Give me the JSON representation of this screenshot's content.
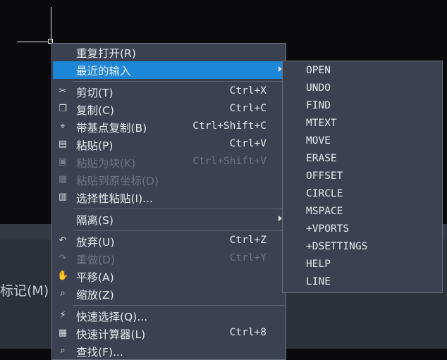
{
  "background": {
    "partial_label": "标记(M)"
  },
  "context_menu": {
    "items": [
      {
        "label": "重复打开(R)",
        "shortcut": "",
        "icon": "none",
        "disabled": false,
        "submenu": false,
        "highlighted": false
      },
      {
        "label": "最近的输入",
        "shortcut": "",
        "icon": "none",
        "disabled": false,
        "submenu": true,
        "highlighted": true
      },
      {
        "label": "剪切(T)",
        "shortcut": "Ctrl+X",
        "icon": "scissors-icon",
        "disabled": false,
        "submenu": false,
        "highlighted": false
      },
      {
        "label": "复制(C)",
        "shortcut": "Ctrl+C",
        "icon": "copy-icon",
        "disabled": false,
        "submenu": false,
        "highlighted": false
      },
      {
        "label": "带基点复制(B)",
        "shortcut": "Ctrl+Shift+C",
        "icon": "copy-with-basepoint-icon",
        "disabled": false,
        "submenu": false,
        "highlighted": false
      },
      {
        "label": "粘贴(P)",
        "shortcut": "Ctrl+V",
        "icon": "paste-icon",
        "disabled": false,
        "submenu": false,
        "highlighted": false
      },
      {
        "label": "粘贴为块(K)",
        "shortcut": "Ctrl+Shift+V",
        "icon": "paste-as-block-icon",
        "disabled": true,
        "submenu": false,
        "highlighted": false
      },
      {
        "label": "粘贴到原坐标(D)",
        "shortcut": "",
        "icon": "paste-original-coords-icon",
        "disabled": true,
        "submenu": false,
        "highlighted": false
      },
      {
        "label": "选择性粘贴(I)...",
        "shortcut": "",
        "icon": "paste-special-icon",
        "disabled": false,
        "submenu": false,
        "highlighted": false
      },
      {
        "label": "隔离(S)",
        "shortcut": "",
        "icon": "none",
        "disabled": false,
        "submenu": true,
        "highlighted": false
      },
      {
        "label": "放弃(U)",
        "shortcut": "Ctrl+Z",
        "icon": "undo-icon",
        "disabled": false,
        "submenu": false,
        "highlighted": false
      },
      {
        "label": "重做(D)",
        "shortcut": "Ctrl+Y",
        "icon": "redo-icon",
        "disabled": true,
        "submenu": false,
        "highlighted": false
      },
      {
        "label": "平移(A)",
        "shortcut": "",
        "icon": "pan-hand-icon",
        "disabled": false,
        "submenu": false,
        "highlighted": false
      },
      {
        "label": "缩放(Z)",
        "shortcut": "",
        "icon": "zoom-icon",
        "disabled": false,
        "submenu": false,
        "highlighted": false
      },
      {
        "label": "快速选择(Q)...",
        "shortcut": "",
        "icon": "quick-select-icon",
        "disabled": false,
        "submenu": false,
        "highlighted": false
      },
      {
        "label": "快速计算器(L)",
        "shortcut": "Ctrl+8",
        "icon": "calculator-icon",
        "disabled": false,
        "submenu": false,
        "highlighted": false
      },
      {
        "label": "查找(F)...",
        "shortcut": "",
        "icon": "find-icon",
        "disabled": false,
        "submenu": false,
        "highlighted": false
      }
    ]
  },
  "recent_input_submenu": {
    "items": [
      "OPEN",
      "UNDO",
      "FIND",
      "MTEXT",
      "MOVE",
      "ERASE",
      "OFFSET",
      "CIRCLE",
      "MSPACE",
      "+VPORTS",
      "+DSETTINGS",
      "HELP",
      "LINE"
    ]
  },
  "colors": {
    "canvas": "#0a0a0c",
    "menu_bg": "#3b4150",
    "highlight": "#1c86d8",
    "text": "#e6e8ec",
    "disabled_text": "#6e7482"
  }
}
